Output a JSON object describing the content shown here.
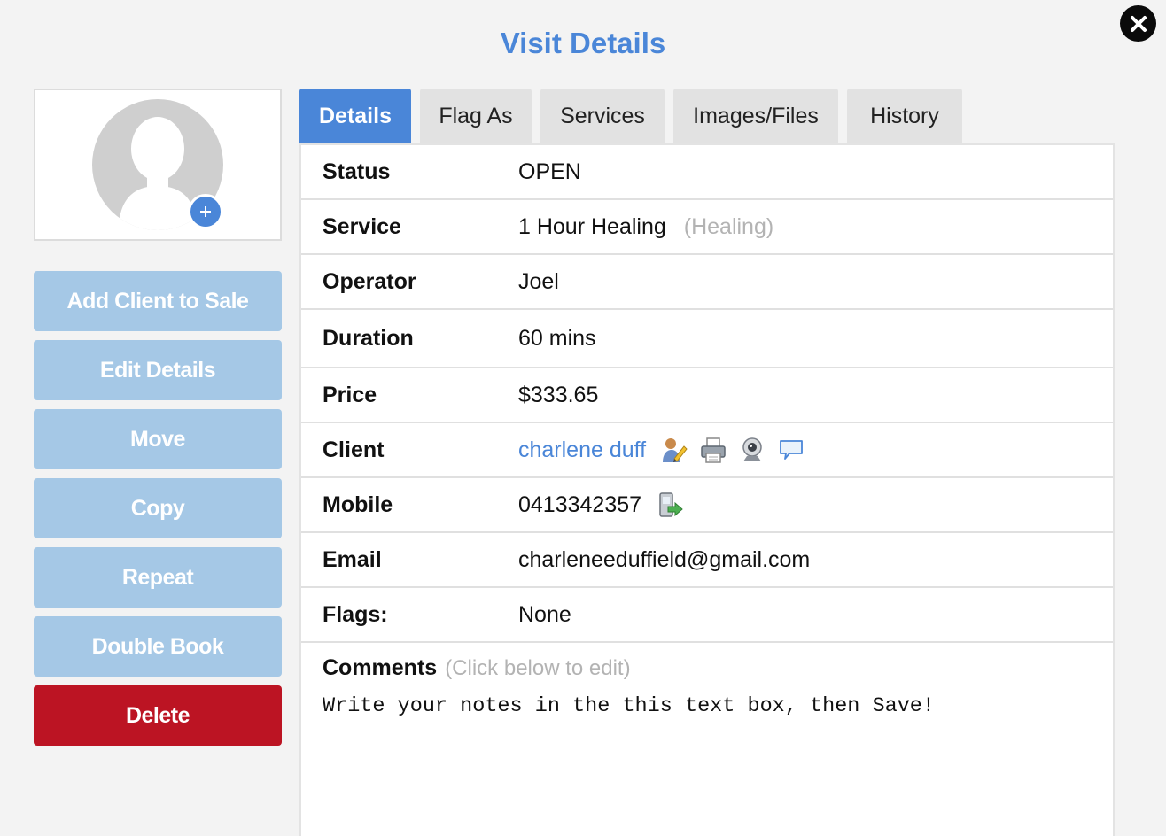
{
  "modal": {
    "title": "Visit Details",
    "close_icon": "close-icon"
  },
  "avatar": {
    "icon": "user-silhouette-icon",
    "add_icon": "plus-icon"
  },
  "actions": [
    {
      "label": "Add Client to Sale",
      "color": "#a5c8e6"
    },
    {
      "label": "Edit Details",
      "color": "#a5c8e6"
    },
    {
      "label": "Move",
      "color": "#a5c8e6"
    },
    {
      "label": "Copy",
      "color": "#a5c8e6"
    },
    {
      "label": "Repeat",
      "color": "#a5c8e6"
    },
    {
      "label": "Double Book",
      "color": "#a5c8e6"
    },
    {
      "label": "Delete",
      "color": "#bc1423"
    }
  ],
  "tabs": [
    {
      "label": "Details",
      "active": true
    },
    {
      "label": "Flag As",
      "active": false
    },
    {
      "label": "Services",
      "active": false
    },
    {
      "label": "Images/Files",
      "active": false
    },
    {
      "label": "History",
      "active": false
    }
  ],
  "details": {
    "status": {
      "label": "Status",
      "value": "OPEN"
    },
    "service": {
      "label": "Service",
      "value": "1 Hour Healing",
      "category": "(Healing)"
    },
    "operator": {
      "label": "Operator",
      "value": "Joel"
    },
    "duration": {
      "label": "Duration",
      "value": "60 mins"
    },
    "price": {
      "label": "Price",
      "value": "$333.65"
    },
    "client": {
      "label": "Client",
      "value": "charlene duff",
      "icons": [
        "edit-client-icon",
        "print-icon",
        "webcam-icon",
        "message-icon"
      ]
    },
    "mobile": {
      "label": "Mobile",
      "value": "0413342357",
      "icons": [
        "send-sms-icon"
      ]
    },
    "email": {
      "label": "Email",
      "value": "charleneeduffield@gmail.com"
    },
    "flags": {
      "label": "Flags:",
      "value": "None"
    }
  },
  "comments": {
    "label": "Comments",
    "hint": "(Click below to edit)",
    "text": "Write your notes in the this text box, then Save!"
  },
  "colors": {
    "accent": "#4a86d8",
    "button_light": "#a5c8e6",
    "danger": "#bc1423",
    "tab_inactive": "#e2e2e2"
  }
}
